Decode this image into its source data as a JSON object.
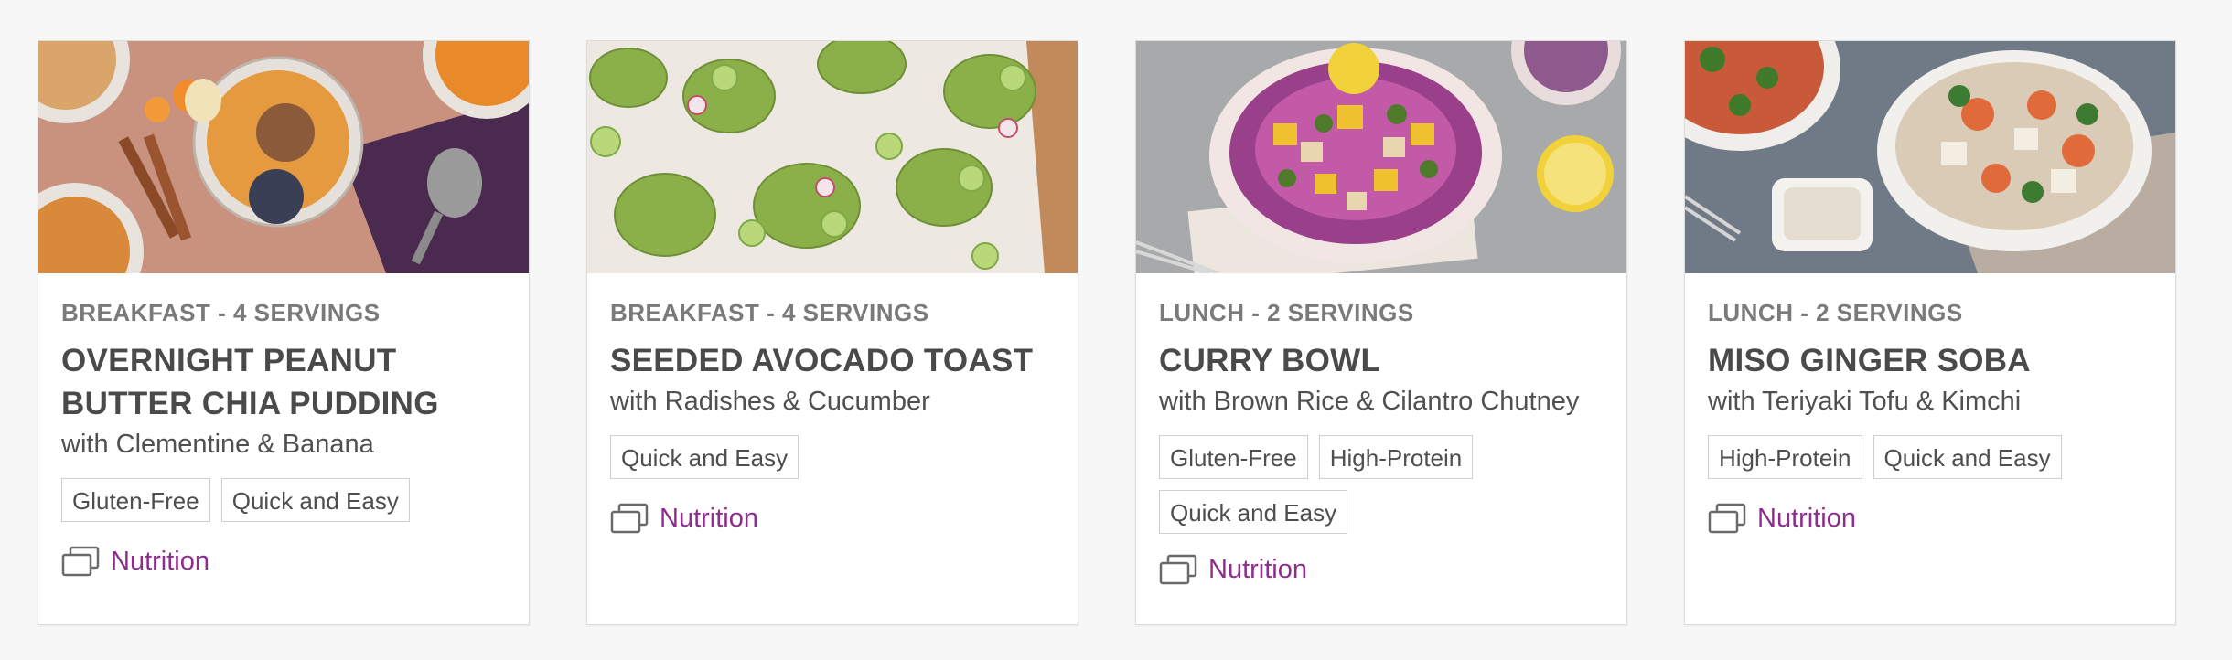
{
  "recipes": [
    {
      "category": "BREAKFAST - 4 SERVINGS",
      "title": "OVERNIGHT PEANUT BUTTER CHIA PUDDING",
      "subtitle": "with Clementine & Banana",
      "tags": [
        "Gluten-Free",
        "Quick and Easy"
      ],
      "nutrition_label": "Nutrition",
      "photo_icon": "chia-pudding-photo"
    },
    {
      "category": "BREAKFAST - 4 SERVINGS",
      "title": "SEEDED AVOCADO TOAST",
      "subtitle": "with Radishes & Cucumber",
      "tags": [
        "Quick and Easy"
      ],
      "nutrition_label": "Nutrition",
      "photo_icon": "avocado-toast-photo"
    },
    {
      "category": "LUNCH - 2 SERVINGS",
      "title": "CURRY BOWL",
      "subtitle": "with Brown Rice & Cilantro Chutney",
      "tags": [
        "Gluten-Free",
        "High-Protein",
        "Quick and Easy"
      ],
      "nutrition_label": "Nutrition",
      "photo_icon": "curry-bowl-photo"
    },
    {
      "category": "LUNCH - 2 SERVINGS",
      "title": "MISO GINGER SOBA",
      "subtitle": "with Teriyaki Tofu & Kimchi",
      "tags": [
        "High-Protein",
        "Quick and Easy"
      ],
      "nutrition_label": "Nutrition",
      "photo_icon": "soba-bowl-photo"
    }
  ],
  "colors": {
    "accent": "#8e2d8e",
    "meta": "#7a7a7a",
    "title": "#4a4a4a"
  }
}
